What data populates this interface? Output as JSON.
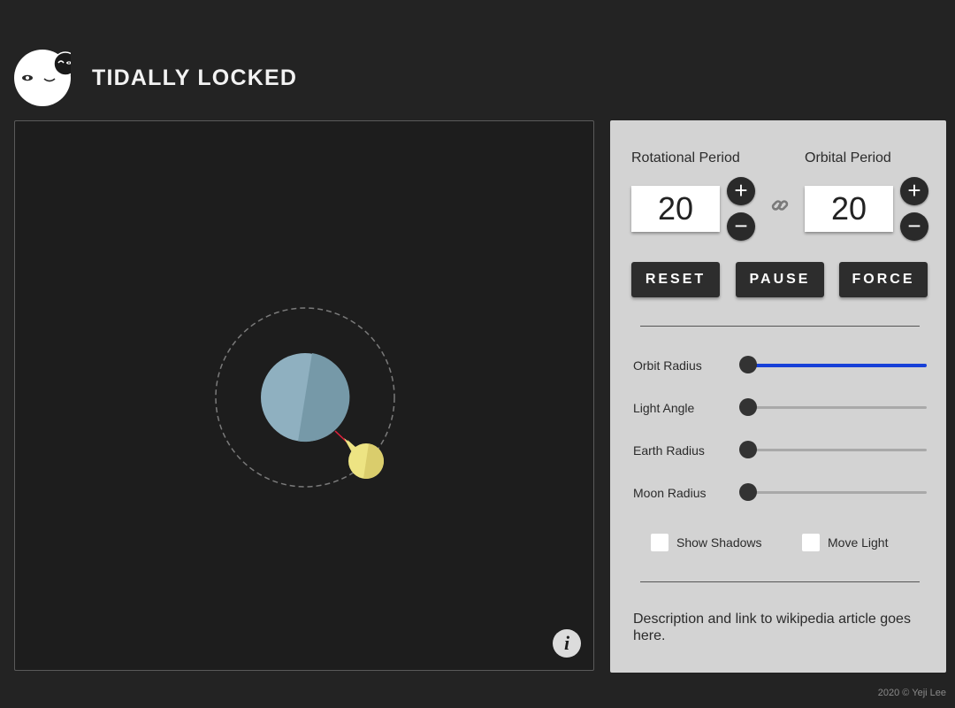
{
  "app": {
    "title": "TIDALLY LOCKED",
    "logo_icon": "winking-moon-logo-icon"
  },
  "simulation": {
    "orbit_style": "dashed",
    "earth_color": "#8fb0c0",
    "earth_shade_color": "#7699a8",
    "moon_color": "#ede483",
    "tidal_line_color": "#e0203c",
    "info_label": "i"
  },
  "controls": {
    "rotational_period": {
      "label": "Rotational Period",
      "value": "20",
      "plus": "+",
      "minus": "−"
    },
    "orbital_period": {
      "label": "Orbital Period",
      "value": "20",
      "plus": "+",
      "minus": "−"
    },
    "link_icon": "chain-link-icon",
    "buttons": {
      "reset": "RESET",
      "pause": "PAUSE",
      "force": "FORCE"
    },
    "sliders": [
      {
        "label": "Orbit Radius",
        "value_fraction": 0.0,
        "active": true
      },
      {
        "label": "Light Angle",
        "value_fraction": 0.0,
        "active": false
      },
      {
        "label": "Earth Radius",
        "value_fraction": 0.0,
        "active": false
      },
      {
        "label": "Moon Radius",
        "value_fraction": 0.0,
        "active": false
      }
    ],
    "slider_active_color": "#1740d8",
    "checkboxes": {
      "show_shadows": {
        "label": "Show Shadows",
        "checked": false
      },
      "move_light": {
        "label": "Move Light",
        "checked": false
      }
    },
    "description": "Description and link to wikipedia article goes here."
  },
  "footer": {
    "text": "2020 © Yeji Lee"
  }
}
